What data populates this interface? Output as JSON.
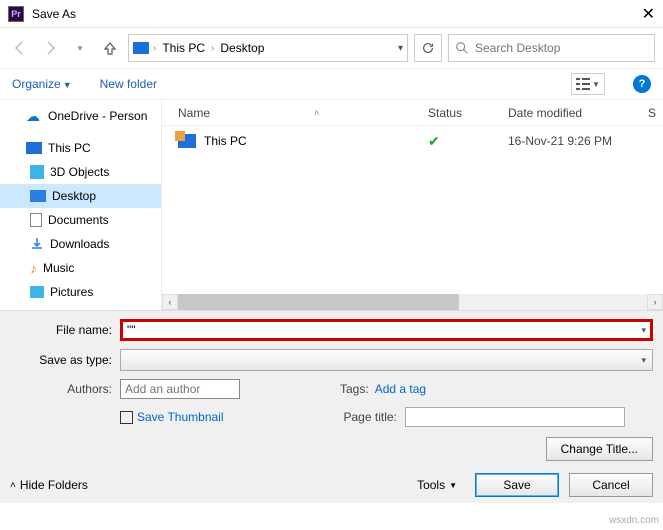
{
  "window": {
    "title": "Save As",
    "close_glyph": "✕"
  },
  "nav": {
    "breadcrumb": [
      "This PC",
      "Desktop"
    ],
    "search_placeholder": "Search Desktop"
  },
  "toolbar": {
    "organize": "Organize",
    "newfolder": "New folder"
  },
  "tree": {
    "items": [
      {
        "name": "onedrive",
        "label": "OneDrive - Person",
        "icon": "cloud",
        "indent": false,
        "chev": ""
      },
      {
        "name": "thispc",
        "label": "This PC",
        "icon": "pc",
        "indent": false,
        "chev": ""
      },
      {
        "name": "3dobjects",
        "label": "3D Objects",
        "icon": "3d",
        "indent": true,
        "chev": ""
      },
      {
        "name": "desktop",
        "label": "Desktop",
        "icon": "desk",
        "indent": true,
        "chev": "",
        "selected": true
      },
      {
        "name": "documents",
        "label": "Documents",
        "icon": "doc",
        "indent": true,
        "chev": ""
      },
      {
        "name": "downloads",
        "label": "Downloads",
        "icon": "dl",
        "indent": true,
        "chev": ""
      },
      {
        "name": "music",
        "label": "Music",
        "icon": "music",
        "indent": true,
        "chev": ""
      },
      {
        "name": "pictures",
        "label": "Pictures",
        "icon": "pic",
        "indent": true,
        "chev": ""
      }
    ]
  },
  "columns": {
    "name": "Name",
    "status": "Status",
    "date": "Date modified",
    "size": "S"
  },
  "rows": [
    {
      "name": "This PC",
      "status": "ok",
      "date": "16-Nov-21 9:26 PM"
    }
  ],
  "form": {
    "filename_label": "File name:",
    "filename_value": "\"\"",
    "type_label": "Save as type:",
    "type_value": "",
    "authors_label": "Authors:",
    "authors_placeholder": "Add an author",
    "tags_label": "Tags:",
    "tags_link": "Add a tag",
    "save_thumb": "Save Thumbnail",
    "pagetitle_label": "Page title:",
    "pagetitle_value": "",
    "change_title": "Change Title..."
  },
  "footer": {
    "hide_folders": "Hide Folders",
    "tools": "Tools",
    "save": "Save",
    "cancel": "Cancel"
  },
  "watermark": "wsxdn.com"
}
